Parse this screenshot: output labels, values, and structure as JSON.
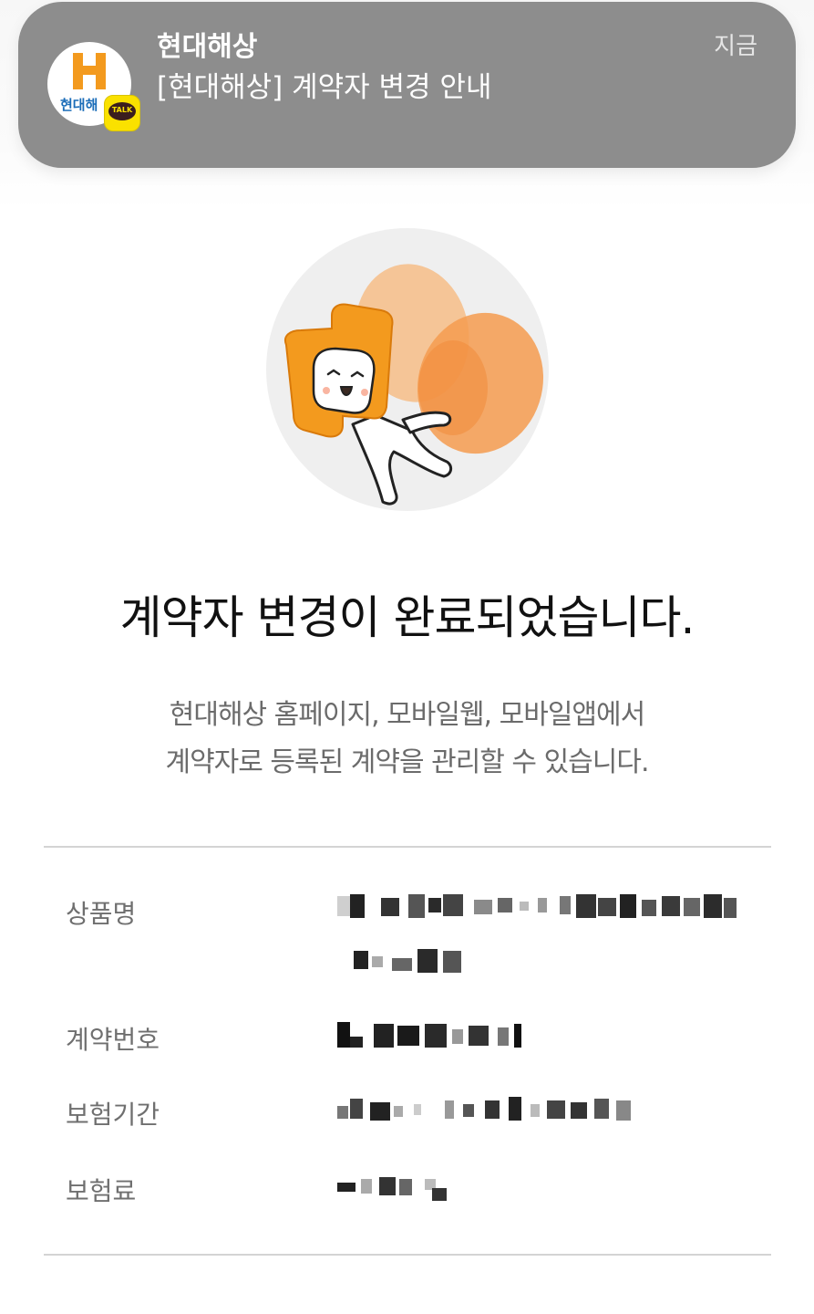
{
  "notification": {
    "app_icon": "hyundai-marine-kakaotalk-icon",
    "app_icon_brand_text": "현대해",
    "talk_badge_text": "TALK",
    "sender": "현대해상",
    "message": "[현대해상] 계약자 변경 안내",
    "time": "지금"
  },
  "illustration": {
    "name": "character-illustration"
  },
  "main": {
    "headline": "계약자 변경이 완료되었습니다.",
    "description_line1": "현대해상 홈페이지, 모바일웹, 모바일앱에서",
    "description_line2": "계약자로 등록된 계약을 관리할 수 있습니다."
  },
  "details": {
    "rows": [
      {
        "label": "상품명",
        "value_visibility": "pixelated"
      },
      {
        "label": "계약번호",
        "value_visibility": "pixelated"
      },
      {
        "label": "보험기간",
        "value_visibility": "pixelated"
      },
      {
        "label": "보험료",
        "value_visibility": "pixelated"
      }
    ]
  },
  "colors": {
    "banner_background": "#8d8d8d",
    "brand_orange": "#f39a1e",
    "kakao_yellow": "#fae100",
    "headline_text": "#111111",
    "description_text": "#6b6b6b",
    "divider": "#d4d4d4"
  }
}
